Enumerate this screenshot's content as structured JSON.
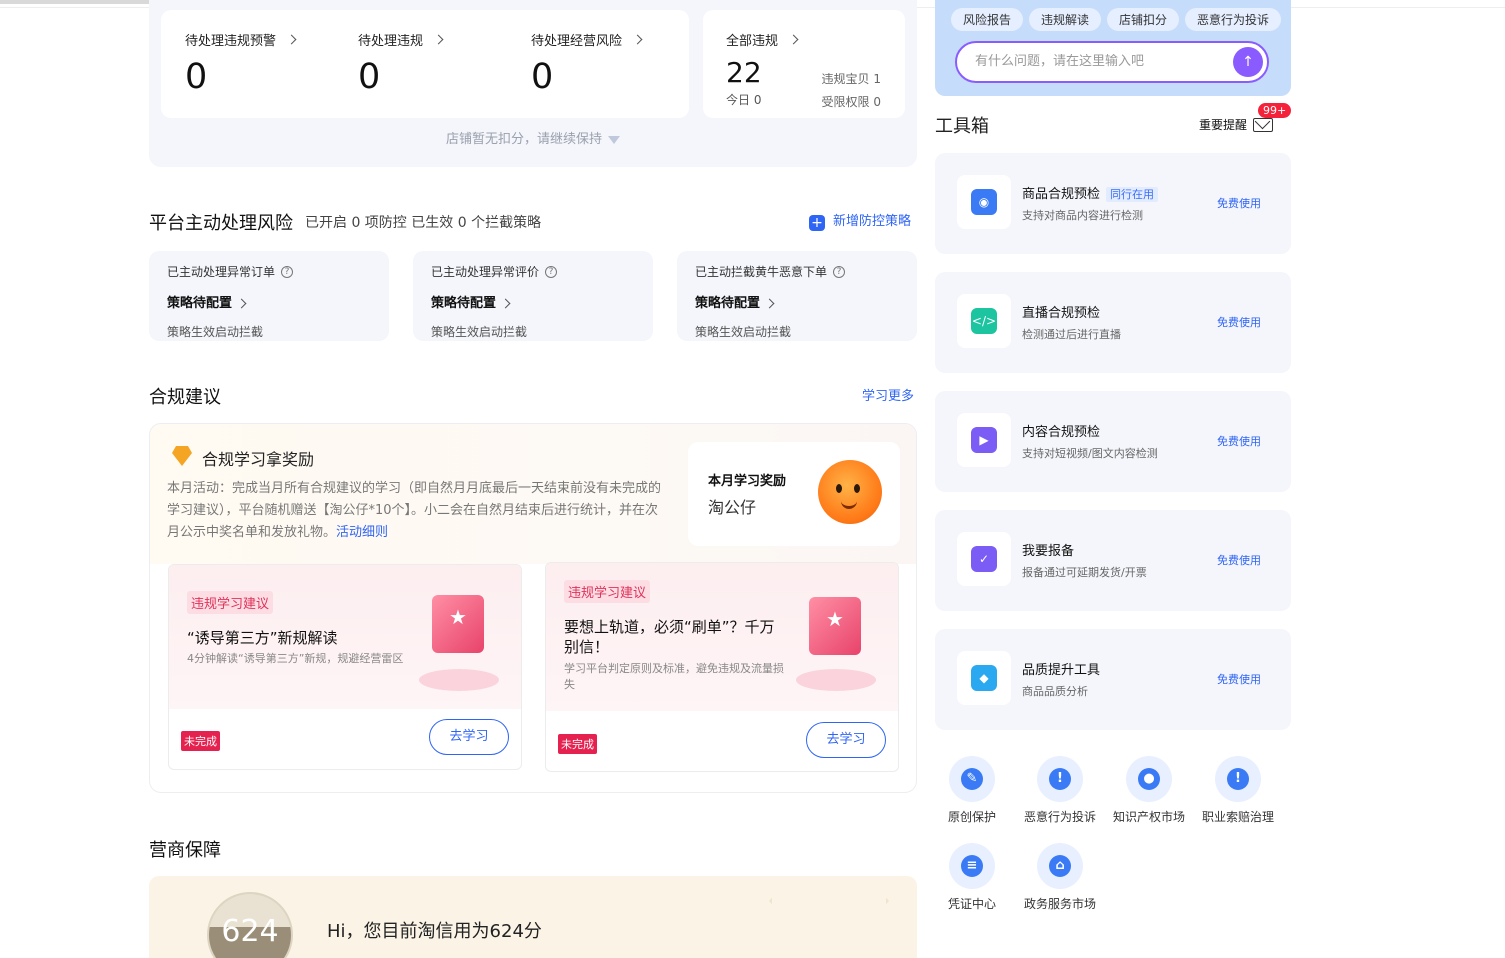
{
  "stats": {
    "items": [
      {
        "label": "待处理违规预警",
        "value": "0"
      },
      {
        "label": "待处理违规",
        "value": "0"
      },
      {
        "label": "待处理经营风险",
        "value": "0"
      }
    ],
    "total": {
      "label": "全部违规",
      "value": "22",
      "today": "今日 0",
      "right1": "违规宝贝 1",
      "right2": "受限权限 0"
    },
    "note": "店铺暂无扣分，请继续保持"
  },
  "platform": {
    "title": "平台主动处理风险",
    "subtitle": "已开启 0 项防控 已生效 0 个拦截策略",
    "add_label": "新增防控策略",
    "cards": [
      {
        "title": "已主动处理异常订单",
        "status": "策略待配置",
        "foot": "策略生效启动拦截"
      },
      {
        "title": "已主动处理异常评价",
        "status": "策略待配置",
        "foot": "策略生效启动拦截"
      },
      {
        "title": "已主动拦截黄牛恶意下单",
        "status": "策略待配置",
        "foot": "策略生效启动拦截"
      }
    ]
  },
  "compliance": {
    "title": "合规建议",
    "more": "学习更多",
    "reward_title": "合规学习拿奖励",
    "desc": "本月活动：完成当月所有合规建议的学习（即自然月月底最后一天结束前没有未完成的学习建议），平台随机赠送【淘公仔*10个】。小二会在自然月结束后进行统计，并在次月公示中奖名单和发放礼物。",
    "detail_link": "活动细则",
    "month_reward_label": "本月学习奖励",
    "month_reward_value": "淘公仔",
    "cards": [
      {
        "tag": "违规学习建议",
        "title": "“诱导第三方”新规解读",
        "desc": "4分钟解读“诱导第三方”新规，规避经营雷区",
        "status": "未完成",
        "button": "去学习"
      },
      {
        "tag": "违规学习建议",
        "title": "要想上轨道，必须“刷单”？千万别信！",
        "desc": "学习平台判定原则及标准，避免违规及流量损失",
        "status": "未完成",
        "button": "去学习"
      }
    ]
  },
  "business": {
    "title": "营商保障",
    "score": "624",
    "text": "Hi，您目前淘信用为624分"
  },
  "assistant": {
    "tabs": [
      "风险报告",
      "违规解读",
      "店铺扣分",
      "恶意行为投诉"
    ],
    "placeholder": "有什么问题，请在这里输入吧"
  },
  "toolbox": {
    "title": "工具箱",
    "reminder_label": "重要提醒",
    "reminder_count": "99+",
    "tools": [
      {
        "name": "商品合规预检",
        "tag": "同行在用",
        "desc": "支持对商品内容进行检测",
        "action": "免费使用",
        "icon": "shield-search-icon",
        "color": "#3a7bf5"
      },
      {
        "name": "直播合规预检",
        "tag": "",
        "desc": "检测通过后进行直播",
        "action": "免费使用",
        "icon": "code-icon",
        "color": "#1cc4a0"
      },
      {
        "name": "内容合规预检",
        "tag": "",
        "desc": "支持对短视频/图文内容检测",
        "action": "免费使用",
        "icon": "video-icon",
        "color": "#7b5cf5"
      },
      {
        "name": "我要报备",
        "tag": "",
        "desc": "报备通过可延期发货/开票",
        "action": "免费使用",
        "icon": "house-check-icon",
        "color": "#7b5cf5"
      },
      {
        "name": "品质提升工具",
        "tag": "",
        "desc": "商品品质分析",
        "action": "免费使用",
        "icon": "diamond-icon",
        "color": "#2aa8f0"
      }
    ],
    "quick": [
      {
        "label": "原创保护",
        "icon": "pen-icon",
        "glyph": "✎"
      },
      {
        "label": "恶意行为投诉",
        "icon": "alert-icon",
        "glyph": "!"
      },
      {
        "label": "知识产权市场",
        "icon": "bulb-icon",
        "glyph": "●"
      },
      {
        "label": "职业索赔治理",
        "icon": "alert-icon",
        "glyph": "!"
      },
      {
        "label": "凭证中心",
        "icon": "certificate-icon",
        "glyph": "≡"
      },
      {
        "label": "政务服务市场",
        "icon": "bank-icon",
        "glyph": "⌂"
      }
    ]
  }
}
